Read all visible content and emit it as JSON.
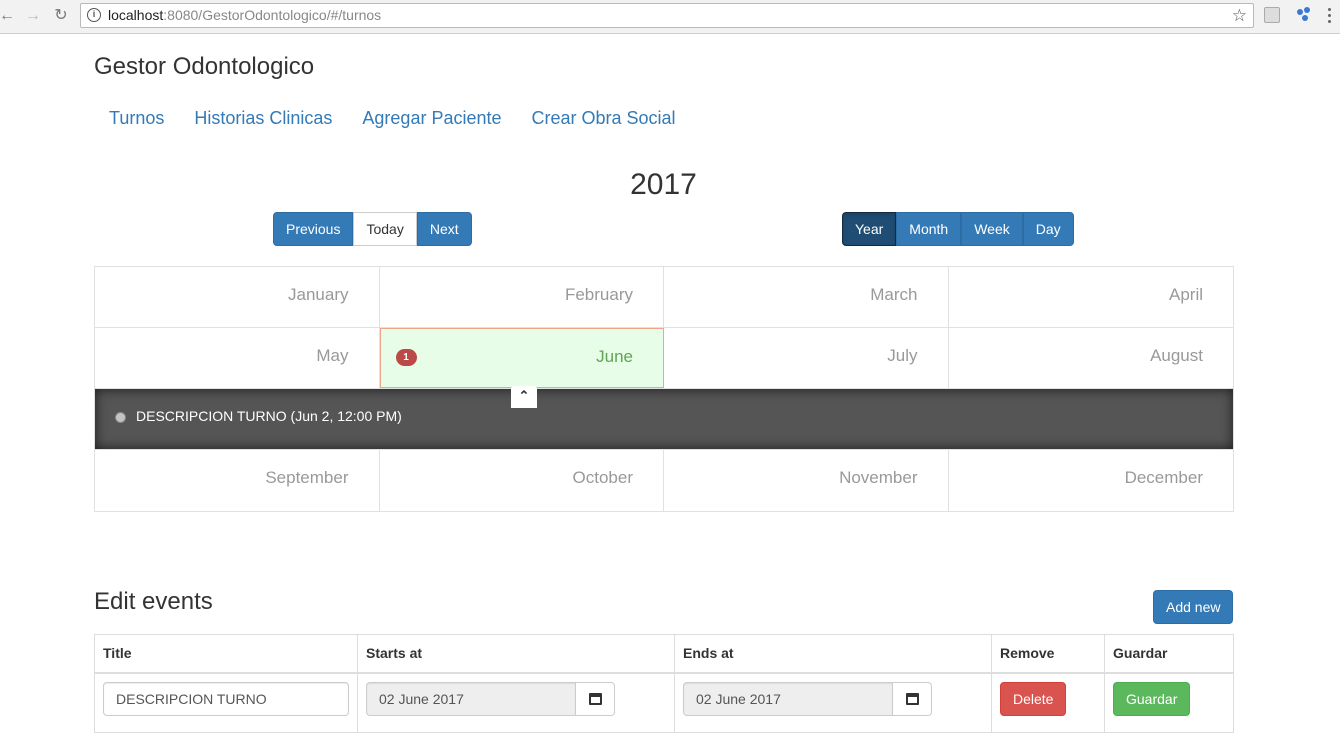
{
  "browser": {
    "url_host": "localhost",
    "url_path": ":8080/GestorOdontologico/#/turnos"
  },
  "brand": "Gestor Odontologico",
  "nav": [
    "Turnos",
    "Historias Clinicas",
    "Agregar Paciente",
    "Crear Obra Social"
  ],
  "calendar": {
    "title": "2017",
    "nav_buttons": {
      "previous": "Previous",
      "today": "Today",
      "next": "Next"
    },
    "view_buttons": {
      "year": "Year",
      "month": "Month",
      "week": "Week",
      "day": "Day",
      "active": "Year"
    },
    "months": [
      "January",
      "February",
      "March",
      "April",
      "May",
      "June",
      "July",
      "August",
      "September",
      "October",
      "November",
      "December"
    ],
    "selected_month": "June",
    "selected_badge": "1",
    "event_slide": {
      "text": "DESCRIPCION TURNO (Jun 2, 12:00 PM)"
    }
  },
  "edit": {
    "title": "Edit events",
    "add_label": "Add new",
    "columns": [
      "Title",
      "Starts at",
      "Ends at",
      "Remove",
      "Guardar"
    ],
    "rows": [
      {
        "title": "DESCRIPCION TURNO",
        "starts": "02 June 2017",
        "ends": "02 June 2017",
        "remove_label": "Delete",
        "save_label": "Guardar"
      }
    ]
  }
}
